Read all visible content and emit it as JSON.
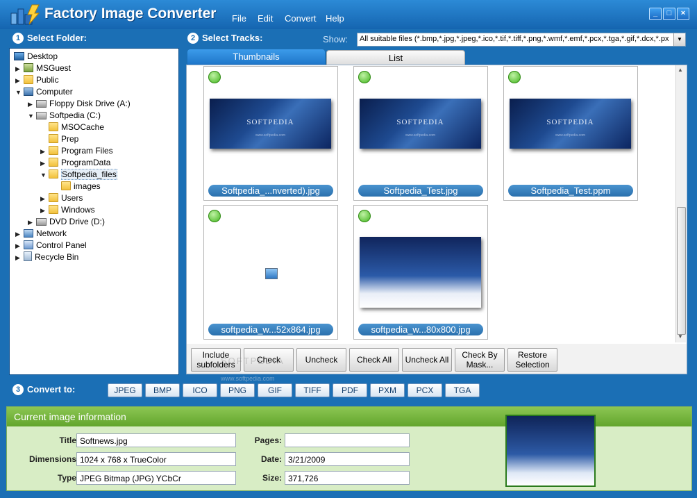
{
  "app": {
    "title": "Factory Image Converter"
  },
  "menu": [
    "File",
    "Edit",
    "Convert",
    "Help"
  ],
  "window_buttons": {
    "minimize": "_",
    "maximize": "□",
    "close": "×"
  },
  "sections": {
    "select_folder": {
      "number": "1",
      "label": "Select Folder:"
    },
    "select_tracks": {
      "number": "2",
      "label": "Select Tracks:"
    },
    "convert_to": {
      "number": "3",
      "label": "Convert to:"
    }
  },
  "show": {
    "label": "Show:",
    "value": "All suitable files (*.bmp,*.jpg,*.jpeg,*.ico,*.tif,*.tiff,*.png,*.wmf,*.emf,*.pcx,*.tga,*.gif,*.dcx,*.pxm,*."
  },
  "tree": [
    {
      "label": "Desktop",
      "icon": "desktop-icon"
    },
    {
      "label": "MSGuest",
      "icon": "user-icon"
    },
    {
      "label": "Public",
      "icon": "folder-icon"
    },
    {
      "label": "Computer",
      "icon": "computer-icon"
    },
    {
      "label": "Floppy Disk Drive (A:)",
      "icon": "floppy-icon"
    },
    {
      "label": "Softpedia (C:)",
      "icon": "drive-icon"
    },
    {
      "label": "MSOCache",
      "icon": "folder-icon"
    },
    {
      "label": "Prep",
      "icon": "folder-icon"
    },
    {
      "label": "Program Files",
      "icon": "folder-icon"
    },
    {
      "label": "ProgramData",
      "icon": "folder-icon"
    },
    {
      "label": "Softpedia_files",
      "icon": "folder-icon"
    },
    {
      "label": "images",
      "icon": "folder-icon"
    },
    {
      "label": "Users",
      "icon": "folder-icon"
    },
    {
      "label": "Windows",
      "icon": "folder-icon"
    },
    {
      "label": "DVD Drive (D:)",
      "icon": "dvd-icon"
    },
    {
      "label": "Network",
      "icon": "network-icon"
    },
    {
      "label": "Control Panel",
      "icon": "control-panel-icon"
    },
    {
      "label": "Recycle Bin",
      "icon": "recycle-bin-icon"
    }
  ],
  "tabs": [
    "Thumbnails",
    "List"
  ],
  "thumbnails": [
    {
      "caption": "Softpedia_...nverted).jpg",
      "wordmark": "SOFTPEDIA",
      "subtext": "www.softpedia.com"
    },
    {
      "caption": "Softpedia_Test.jpg",
      "wordmark": "SOFTPEDIA",
      "subtext": "www.softpedia.com"
    },
    {
      "caption": "Softpedia_Test.ppm",
      "wordmark": "SOFTPEDIA",
      "subtext": "www.softpedia.com"
    },
    {
      "caption": "softpedia_w...52x864.jpg"
    },
    {
      "caption": "softpedia_w...80x800.jpg"
    }
  ],
  "actions": [
    "Include subfolders",
    "Check",
    "Uncheck",
    "Check All",
    "Uncheck All",
    "Check By Mask...",
    "Restore Selection"
  ],
  "watermark": "SOFTPEDIA",
  "watermark_url": "www.softpedia.com",
  "formats": [
    "JPEG",
    "BMP",
    "ICO",
    "PNG",
    "GIF",
    "TIFF",
    "PDF",
    "PXM",
    "PCX",
    "TGA"
  ],
  "info": {
    "heading": "Current image information",
    "title_label": "Title:",
    "title": "Softnews.jpg",
    "dimensions_label": "Dimensions:",
    "dimensions": "1024 x 768 x TrueColor",
    "type_label": "Type:",
    "type": "JPEG Bitmap (JPG) YCbCr",
    "pages_label": "Pages:",
    "pages": "",
    "date_label": "Date:",
    "date": "3/21/2009",
    "size_label": "Size:",
    "size": "371,726"
  },
  "colors": {
    "frame": "#1b6fb5",
    "accent_green": "#62a52c",
    "tab_active": "#1e76c9"
  }
}
